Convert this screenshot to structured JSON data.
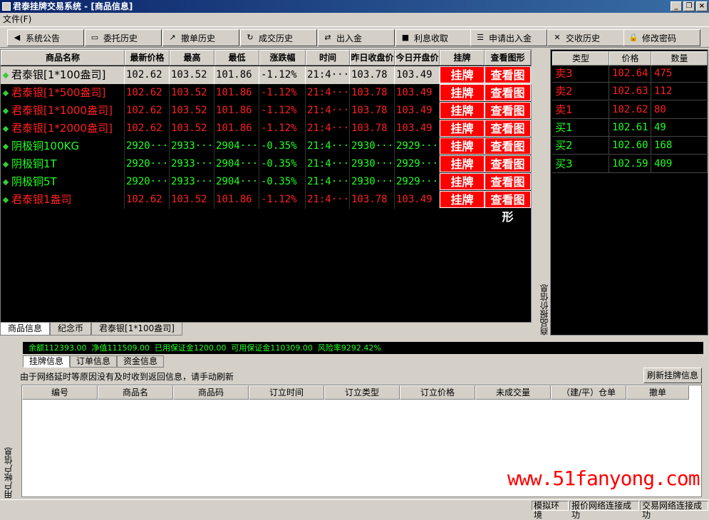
{
  "window": {
    "title": "君泰挂牌交易系统 - [商品信息]",
    "controls": {
      "minimize": "_",
      "restore": "❐",
      "close": "×"
    }
  },
  "menu": {
    "file": "文件(F)"
  },
  "toolbar": [
    {
      "label": "系统公告",
      "icon": "speaker-icon"
    },
    {
      "label": "委托历史",
      "icon": "monitor-icon"
    },
    {
      "label": "撤单历史",
      "icon": "export-icon"
    },
    {
      "label": "成交历史",
      "icon": "refresh-icon"
    },
    {
      "label": "出入金",
      "icon": "transfer-icon"
    },
    {
      "label": "利息收取",
      "icon": "box-icon"
    },
    {
      "label": "申请出入金",
      "icon": "list-icon"
    },
    {
      "label": "交收历史",
      "icon": "exchange-icon"
    },
    {
      "label": "修改密码",
      "icon": "lock-icon"
    }
  ],
  "products": {
    "columns": [
      "商品名称",
      "最新价格",
      "最高",
      "最低",
      "涨跌幅",
      "时间",
      "昨日收盘价",
      "今日开盘价",
      "挂牌",
      "查看图形"
    ],
    "rows": [
      {
        "name": "君泰银[1*100盎司]",
        "last": "102.62",
        "high": "103.52",
        "low": "101.86",
        "change": "-1.12%",
        "time": "21:4···",
        "prev_close": "103.78",
        "open": "103.49",
        "color": "red"
      },
      {
        "name": "君泰银[1*500盎司]",
        "last": "102.62",
        "high": "103.52",
        "low": "101.86",
        "change": "-1.12%",
        "time": "21:4···",
        "prev_close": "103.78",
        "open": "103.49",
        "color": "red"
      },
      {
        "name": "君泰银[1*1000盎司]",
        "last": "102.62",
        "high": "103.52",
        "low": "101.86",
        "change": "-1.12%",
        "time": "21:4···",
        "prev_close": "103.78",
        "open": "103.49",
        "color": "red"
      },
      {
        "name": "君泰银[1*2000盎司]",
        "last": "102.62",
        "high": "103.52",
        "low": "101.86",
        "change": "-1.12%",
        "time": "21:4···",
        "prev_close": "103.78",
        "open": "103.49",
        "color": "red"
      },
      {
        "name": "阴极铜100KG",
        "last": "2920···",
        "high": "2933···",
        "low": "2904···",
        "change": "-0.35%",
        "time": "21:4···",
        "prev_close": "2930···",
        "open": "2929···",
        "color": "green"
      },
      {
        "name": "阴极铜1T",
        "last": "2920···",
        "high": "2933···",
        "low": "2904···",
        "change": "-0.35%",
        "time": "21:4···",
        "prev_close": "2930···",
        "open": "2929···",
        "color": "green"
      },
      {
        "name": "阴极铜5T",
        "last": "2920···",
        "high": "2933···",
        "low": "2904···",
        "change": "-0.35%",
        "time": "21:4···",
        "prev_close": "2930···",
        "open": "2929···",
        "color": "green"
      },
      {
        "name": "君泰银1盎司",
        "last": "102.62",
        "high": "103.52",
        "low": "101.86",
        "change": "-1.12%",
        "time": "21:4···",
        "prev_close": "103.78",
        "open": "103.49",
        "color": "red"
      }
    ],
    "list_button": "挂牌",
    "chart_button": "查看图形"
  },
  "bottom_tabs": [
    "商品信息",
    "纪念币",
    "君泰银[1*100盎司]"
  ],
  "quote_panel": {
    "side_label": "商品报价信息",
    "columns": [
      "类型",
      "价格",
      "数量"
    ],
    "rows": [
      {
        "type": "卖3",
        "price": "102.64",
        "qty": "475",
        "color": "red"
      },
      {
        "type": "卖2",
        "price": "102.63",
        "qty": "112",
        "color": "red"
      },
      {
        "type": "卖1",
        "price": "102.62",
        "qty": "80",
        "color": "red"
      },
      {
        "type": "买1",
        "price": "102.61",
        "qty": "49",
        "color": "green"
      },
      {
        "type": "买2",
        "price": "102.60",
        "qty": "168",
        "color": "green"
      },
      {
        "type": "买3",
        "price": "102.59",
        "qty": "409",
        "color": "green"
      }
    ]
  },
  "account": {
    "side_label": "用户帐户信息",
    "balance_line": "余额112393.00  净值111509.00  已用保证金1200.00  可用保证金110309.00  风险率9292.42%",
    "tabs": [
      "挂牌信息",
      "订单信息",
      "资金信息"
    ],
    "note": "由于网络延时等原因没有及时收到返回信息，请手动刷新",
    "refresh_button": "刷新挂牌信息",
    "columns": [
      "编号",
      "商品名",
      "商品码",
      "订立时间",
      "订立类型",
      "订立价格",
      "未成交量",
      "（建/平）仓单",
      "撤单"
    ]
  },
  "watermark": "www.51fanyong.com",
  "status": [
    "模拟环境",
    "报价网络连接成功",
    "交易网络连接成功"
  ]
}
